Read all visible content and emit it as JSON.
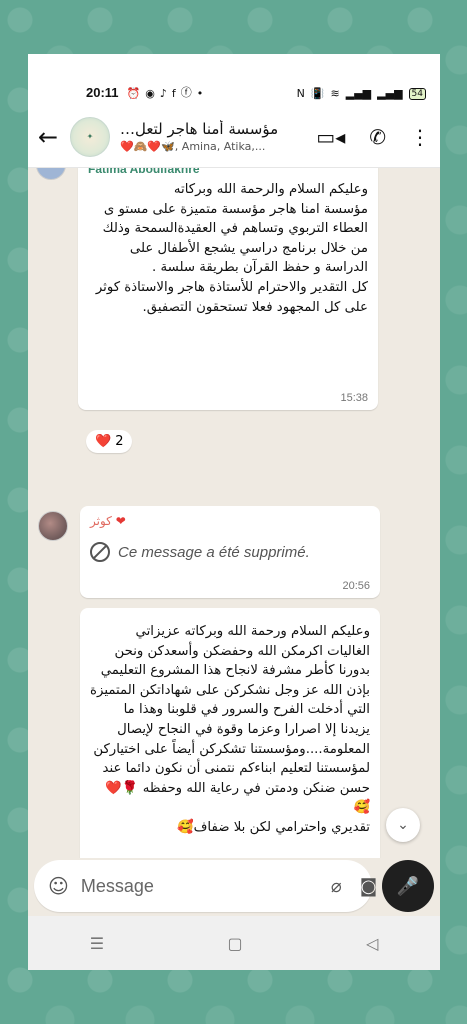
{
  "status_bar": {
    "time": "20:11",
    "battery": "54"
  },
  "header": {
    "title": "مؤسسة أمنا هاجر لتعل…",
    "subtitle_emoji": "❤️🙈❤️🦋",
    "subtitle_names": ", Amina, Atika,...",
    "icons": [
      "back-arrow-icon",
      "video-call-icon",
      "phone-icon",
      "more-vert-icon"
    ]
  },
  "messages": [
    {
      "sender": "Fatima Aboulfakhre",
      "text": "وعليكم السلام والرحمة الله وبركاته\nمؤسسة امنا هاجر مؤسسة متميزة على مستو ى العطاء التربوي وتساهم في العقيدةالسمحة وذلك من خلال برنامج دراسي يشجع الأطفال على الدراسة و حفظ القرآن بطريقة سلسة .\nكل التقدير والاحترام للأستاذة هاجر والاستاذة كوثر على كل المجهود فعلا تستحقون التصفيق.",
      "time": "15:38",
      "reaction": "❤️",
      "reaction_count": "2"
    },
    {
      "sender": "كوثر",
      "text": "Ce message a été supprimé.",
      "time": "20:56"
    },
    {
      "text": "وعليكم السلام ورحمة الله وبركاته عزيزاتي الغاليات اكرمكن الله وحفضكن وأسعدكن ونحن بدورنا كأطر مشرفة لانجاح هذا المشروع التعليمي بإذن الله عز وجل نشكركن على شهاداتكن المتميزة التي أدخلت الفرح والسرور في قلوبنا وهذا ما يزيدنا إلا اصرارا وعزما وقوة في النجاح لإيصال المعلومة....ومؤسستنا تشكركن أيضاً على اختياركن لمؤسستنا لتعليم ابناءكم نتمنى أن نكون دائما عند حسن ضنكن ودمتن في رعاية الله وحفظه 🌹❤️🥰\nتقديري واحترامي لكن بلا ضفاف🥰"
    }
  ],
  "composer": {
    "placeholder": "Message"
  }
}
